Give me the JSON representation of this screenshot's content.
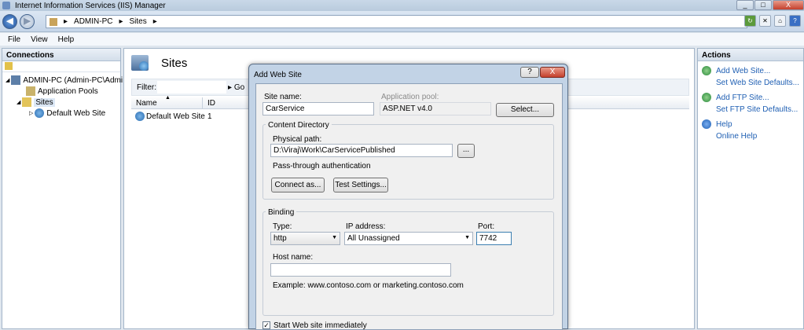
{
  "window": {
    "title": "Internet Information Services (IIS) Manager",
    "minimize": "_",
    "maximize": "□",
    "close": "X"
  },
  "address": {
    "crumbs": [
      "ADMIN-PC",
      "Sites"
    ],
    "sep": "▸"
  },
  "menu": [
    "File",
    "View",
    "Help"
  ],
  "connections": {
    "header": "Connections",
    "tree": {
      "server": "ADMIN-PC (Admin-PC\\Admi",
      "app_pools": "Application Pools",
      "sites": "Sites",
      "default_site": "Default Web Site"
    }
  },
  "sites": {
    "title": "Sites",
    "filter_label": "Filter:",
    "go": "Go",
    "columns": [
      "Name",
      "ID"
    ],
    "rows": [
      {
        "name": "Default Web Site",
        "id": "1"
      }
    ]
  },
  "actions": {
    "header": "Actions",
    "items": [
      "Add Web Site...",
      "Set Web Site Defaults...",
      "Add FTP Site...",
      "Set FTP Site Defaults...",
      "Help",
      "Online Help"
    ]
  },
  "dialog": {
    "title": "Add Web Site",
    "help_btn": "?",
    "close_btn": "X",
    "site_name_label": "Site name:",
    "site_name": "CarService",
    "app_pool_label": "Application pool:",
    "app_pool": "ASP.NET v4.0",
    "select": "Select...",
    "content_dir": "Content Directory",
    "physical_path_label": "Physical path:",
    "physical_path": "D:\\Viraj\\Work\\CarServicePublished",
    "browse": "...",
    "passthrough": "Pass-through authentication",
    "connect_as": "Connect as...",
    "test_settings": "Test Settings...",
    "binding": "Binding",
    "type_label": "Type:",
    "type": "http",
    "ip_label": "IP address:",
    "ip": "All Unassigned",
    "port_label": "Port:",
    "port": "7742",
    "host_label": "Host name:",
    "host": "",
    "example": "Example: www.contoso.com or marketing.contoso.com",
    "start_label": "Start Web site immediately"
  }
}
